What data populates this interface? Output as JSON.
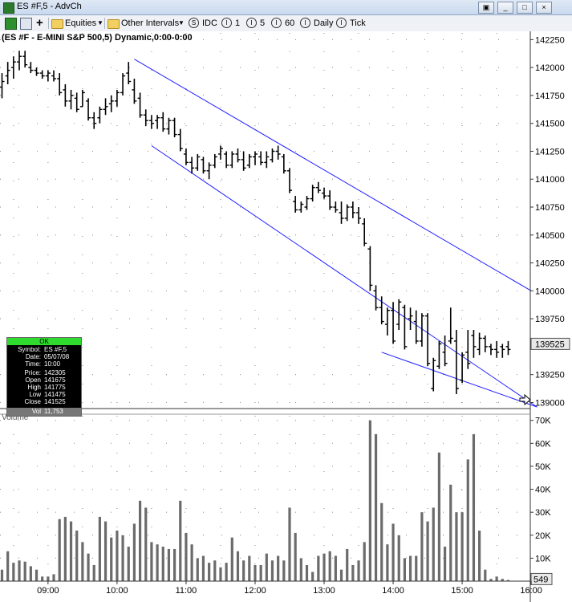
{
  "window": {
    "title": "ES #F,5 - AdvCh",
    "buttons": [
      "▣",
      "_",
      "□",
      "×"
    ]
  },
  "toolbar": {
    "plus": "+",
    "symbol_group": "Equities",
    "intervals_label": "Other Intervals",
    "interval_items": [
      {
        "glyph": "S",
        "label": "IDC"
      },
      {
        "glyph": "I",
        "label": "1"
      },
      {
        "glyph": "I",
        "label": "5"
      },
      {
        "glyph": "I",
        "label": "60"
      },
      {
        "glyph": "I",
        "label": "Daily"
      },
      {
        "glyph": "I",
        "label": "Tick"
      }
    ]
  },
  "chart_data": {
    "type": "candlestick",
    "title": "(ES #F - E-MINI S&P 500,5) Dynamic,0:00-0:00",
    "price_axis": {
      "ticks": [
        "142250",
        "142000",
        "141750",
        "141500",
        "141250",
        "141000",
        "140750",
        "140500",
        "140250",
        "140000",
        "139750",
        "139525",
        "139250",
        "139000"
      ],
      "range": [
        138960,
        142310
      ],
      "last_price": "139525"
    },
    "volume_pane": {
      "label": "Volume",
      "ticks": [
        "70K",
        "60K",
        "50K",
        "40K",
        "30K",
        "20K",
        "10K"
      ],
      "range": [
        0,
        72000
      ],
      "last_volume": "549"
    },
    "time_axis": {
      "labels": [
        "09:00",
        "10:00",
        "11:00",
        "12:00",
        "13:00",
        "14:00",
        "15:00",
        "16:00"
      ]
    },
    "colors": {
      "bar": "#000000",
      "volume": "#6b6b6b",
      "channel": "#1f1fff",
      "grid": "#9a9a9a"
    },
    "bars": [
      [
        141825,
        141950,
        141725,
        141875
      ],
      [
        141925,
        142050,
        141850,
        141975
      ],
      [
        142000,
        142100,
        141900,
        142050
      ],
      [
        142050,
        142150,
        141975,
        142100
      ],
      [
        142100,
        142150,
        142000,
        142025
      ],
      [
        142000,
        142050,
        141950,
        141975
      ],
      [
        141975,
        142000,
        141925,
        141950
      ],
      [
        141950,
        141975,
        141900,
        141925
      ],
      [
        141925,
        141975,
        141875,
        141950
      ],
      [
        141925,
        141975,
        141875,
        141900
      ],
      [
        141900,
        141950,
        141750,
        141775
      ],
      [
        141800,
        141850,
        141650,
        141700
      ],
      [
        141700,
        141800,
        141625,
        141750
      ],
      [
        141725,
        141775,
        141600,
        141625
      ],
      [
        141650,
        141800,
        141650,
        141775
      ],
      [
        141700,
        141725,
        141525,
        141550
      ],
      [
        141550,
        141600,
        141450,
        141500
      ],
      [
        141550,
        141650,
        141500,
        141625
      ],
      [
        141625,
        141725,
        141575,
        141650
      ],
      [
        141675,
        141750,
        141600,
        141700
      ],
      [
        141700,
        141800,
        141650,
        141775
      ],
      [
        141775,
        141950,
        141750,
        141925
      ],
      [
        141950,
        142050,
        141850,
        141875
      ],
      [
        141800,
        141900,
        141675,
        141700
      ],
      [
        141725,
        141775,
        141550,
        141575
      ],
      [
        141575,
        141625,
        141475,
        141525
      ],
      [
        141525,
        141575,
        141450,
        141500
      ],
      [
        141525,
        141575,
        141450,
        141550
      ],
      [
        141550,
        141600,
        141425,
        141450
      ],
      [
        141450,
        141550,
        141400,
        141525
      ],
      [
        141525,
        141550,
        141375,
        141400
      ],
      [
        141400,
        141450,
        141250,
        141275
      ],
      [
        141225,
        141275,
        141125,
        141150
      ],
      [
        141150,
        141200,
        141050,
        141100
      ],
      [
        141100,
        141225,
        141075,
        141200
      ],
      [
        141175,
        141200,
        141050,
        141075
      ],
      [
        141075,
        141150,
        141000,
        141125
      ],
      [
        141125,
        141225,
        141100,
        141200
      ],
      [
        141225,
        141300,
        141175,
        141275
      ],
      [
        141225,
        141250,
        141100,
        141125
      ],
      [
        141125,
        141250,
        141100,
        141225
      ],
      [
        141225,
        141275,
        141150,
        141175
      ],
      [
        141175,
        141250,
        141075,
        141100
      ],
      [
        141125,
        141225,
        141100,
        141200
      ],
      [
        141200,
        141250,
        141125,
        141225
      ],
      [
        141200,
        141250,
        141125,
        141150
      ],
      [
        141150,
        141250,
        141100,
        141200
      ],
      [
        141175,
        141275,
        141150,
        141250
      ],
      [
        141250,
        141300,
        141175,
        141225
      ],
      [
        141200,
        141225,
        141050,
        141075
      ],
      [
        141075,
        141100,
        140875,
        140900
      ],
      [
        140800,
        140850,
        140700,
        140725
      ],
      [
        140725,
        140800,
        140700,
        140775
      ],
      [
        140750,
        140850,
        140725,
        140825
      ],
      [
        140825,
        140950,
        140800,
        140925
      ],
      [
        140925,
        140975,
        140875,
        140900
      ],
      [
        140875,
        140925,
        140825,
        140850
      ],
      [
        140850,
        140900,
        140725,
        140750
      ],
      [
        140750,
        140800,
        140700,
        140725
      ],
      [
        140700,
        140800,
        140600,
        140650
      ],
      [
        140650,
        140775,
        140625,
        140750
      ],
      [
        140750,
        140800,
        140650,
        140700
      ],
      [
        140700,
        140750,
        140600,
        140650
      ],
      [
        140600,
        140650,
        140400,
        140425
      ],
      [
        140375,
        140400,
        140000,
        140050
      ],
      [
        140000,
        140050,
        139825,
        139850
      ],
      [
        139850,
        139950,
        139700,
        139725
      ],
      [
        139700,
        139850,
        139600,
        139825
      ],
      [
        139825,
        139900,
        139525,
        139550
      ],
      [
        139700,
        139925,
        139650,
        139900
      ],
      [
        139850,
        139875,
        139475,
        139500
      ],
      [
        139750,
        139850,
        139650,
        139775
      ],
      [
        139725,
        139825,
        139525,
        139550
      ],
      [
        139550,
        139800,
        139500,
        139775
      ],
      [
        139775,
        139800,
        139325,
        139350
      ],
      [
        139125,
        139400,
        139100,
        139375
      ],
      [
        139325,
        139550,
        139300,
        139525
      ],
      [
        139450,
        139600,
        139325,
        139350
      ],
      [
        139550,
        139850,
        139525,
        139575
      ],
      [
        139550,
        139650,
        139075,
        139125
      ],
      [
        139200,
        139450,
        139175,
        139425
      ],
      [
        139450,
        139650,
        139300,
        139350
      ],
      [
        139600,
        139650,
        139400,
        139500
      ],
      [
        139475,
        139625,
        139425,
        139575
      ],
      [
        139575,
        139600,
        139450,
        139500
      ],
      [
        139500,
        139525,
        139425,
        139475
      ],
      [
        139475,
        139550,
        139400,
        139450
      ],
      [
        139500,
        139525,
        139400,
        139475
      ],
      [
        139500,
        139550,
        139425,
        139475
      ]
    ],
    "volumes": [
      5000,
      13000,
      8000,
      9000,
      8500,
      6500,
      5000,
      2000,
      2000,
      3000,
      27000,
      28000,
      26000,
      22000,
      17000,
      12000,
      7000,
      28000,
      26000,
      19000,
      22000,
      20000,
      15000,
      25000,
      35000,
      32000,
      17000,
      16000,
      15000,
      14000,
      14000,
      35000,
      21000,
      16000,
      10000,
      11000,
      8000,
      9000,
      6000,
      8000,
      19000,
      13000,
      9000,
      11000,
      7000,
      7000,
      12000,
      9000,
      11000,
      9000,
      32000,
      21000,
      10000,
      7000,
      4000,
      11000,
      12000,
      13000,
      11000,
      5000,
      14000,
      7000,
      9000,
      17000,
      70000,
      64000,
      34000,
      16000,
      25000,
      20000,
      10000,
      11000,
      11000,
      30000,
      26000,
      32000,
      56000,
      15000,
      42000,
      30000,
      30000,
      53000,
      64000,
      22000,
      5000,
      1000,
      2000,
      1000,
      500
    ],
    "channel": {
      "upper": [
        [
          23,
          142075
        ],
        [
          92,
          140000
        ]
      ],
      "lower": [
        [
          26,
          141300
        ],
        [
          93,
          138960
        ]
      ],
      "lower_short": [
        [
          66,
          139450
        ],
        [
          93,
          138960
        ]
      ]
    }
  },
  "infobox": {
    "status": "OK",
    "rows": [
      {
        "k": "Symbol:",
        "v": "ES #F,5"
      },
      {
        "k": "Date:",
        "v": "05/07/08"
      },
      {
        "k": "Time:",
        "v": "10:00"
      },
      {
        "k": "Price:",
        "v": "142305"
      },
      {
        "k": "Open",
        "v": "141675"
      },
      {
        "k": "High",
        "v": "141775"
      },
      {
        "k": "Low",
        "v": "141475"
      },
      {
        "k": "Close",
        "v": "141525"
      }
    ],
    "vol_label": "Vol",
    "vol_value": "11,753"
  }
}
